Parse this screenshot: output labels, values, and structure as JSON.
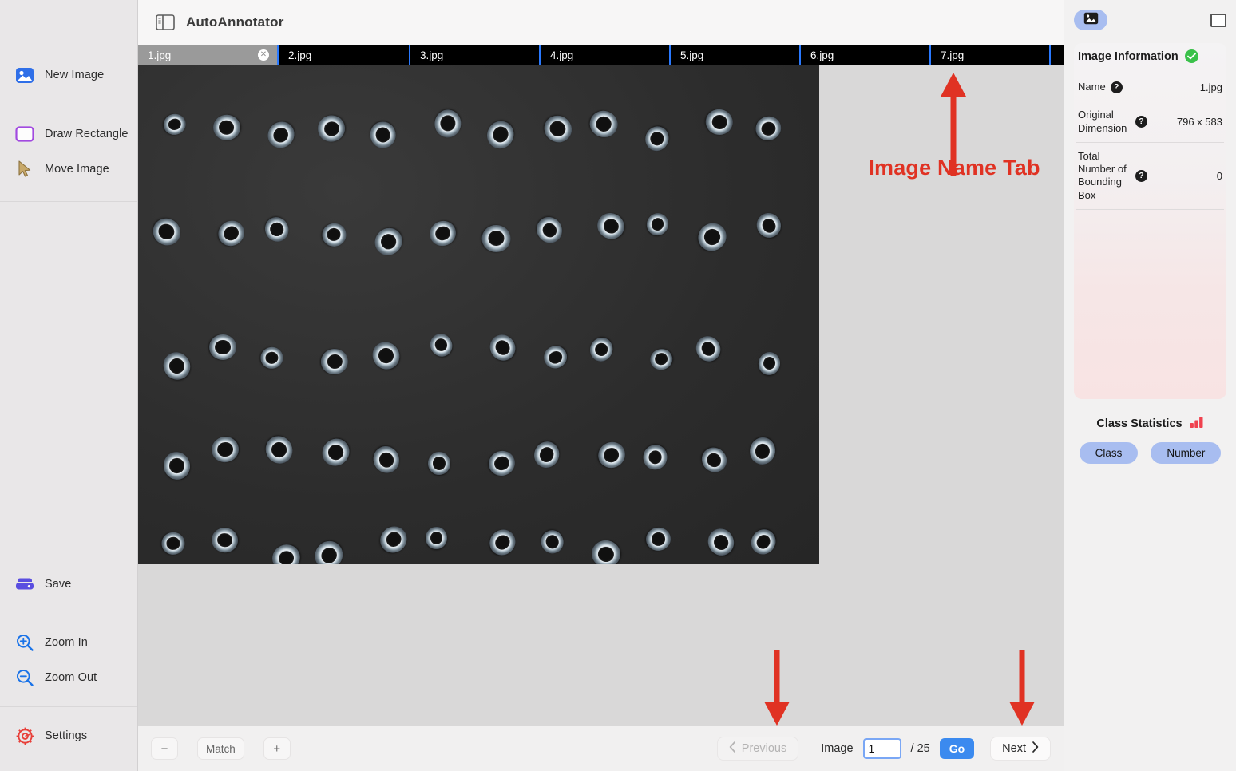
{
  "app": {
    "title": "AutoAnnotator",
    "panel_toggle_icon": "sidebar-panel-icon"
  },
  "sidebar": {
    "items": [
      {
        "label": "New Image",
        "icon": "image-plus-icon"
      },
      {
        "label": "Draw Rectangle",
        "icon": "rectangle-icon"
      },
      {
        "label": "Move Image",
        "icon": "cursor-arrow-icon"
      },
      {
        "label": "Save",
        "icon": "floppy-disk-icon"
      },
      {
        "label": "Zoom In",
        "icon": "magnifier-plus-icon"
      },
      {
        "label": "Zoom Out",
        "icon": "magnifier-minus-icon"
      },
      {
        "label": "Settings",
        "icon": "gear-icon"
      }
    ]
  },
  "tabs": {
    "items": [
      {
        "label": "1.jpg",
        "active": true,
        "closable": true
      },
      {
        "label": "2.jpg",
        "active": false,
        "closable": false
      },
      {
        "label": "3.jpg",
        "active": false,
        "closable": false
      },
      {
        "label": "4.jpg",
        "active": false,
        "closable": false
      },
      {
        "label": "5.jpg",
        "active": false,
        "closable": false
      },
      {
        "label": "6.jpg",
        "active": false,
        "closable": false
      },
      {
        "label": "7.jpg",
        "active": false,
        "closable": false
      }
    ],
    "close_glyph": "✕"
  },
  "bottombar": {
    "zoom_out_label": "−",
    "match_label": "Match",
    "zoom_in_label": "+",
    "previous_label": "Previous",
    "previous_icon": "chevron-left-icon",
    "image_label": "Image",
    "page_value": "1",
    "page_total": "/ 25",
    "go_label": "Go",
    "next_label": "Next",
    "next_icon": "chevron-right-icon"
  },
  "right_panel": {
    "tab_image_icon": "image-icon",
    "tab_box_icon": "bounding-box-icon",
    "info_title": "Image Information",
    "info_status_icon": "check-circle-icon",
    "rows": [
      {
        "key": "Name",
        "help": "?",
        "value": "1.jpg"
      },
      {
        "key": "Original Dimension",
        "help": "?",
        "value": "796 x 583"
      },
      {
        "key": "Total Number of Bounding Box",
        "help": "?",
        "value": "0"
      }
    ],
    "stats_title": "Class Statistics",
    "stats_icon": "bar-chart-icon",
    "pills": [
      {
        "label": "Class"
      },
      {
        "label": "Number"
      }
    ]
  },
  "annotations": {
    "accent_color": "#e03223",
    "callouts": [
      {
        "text": "Image Name Tab",
        "arrow": "arrow-up-icon"
      },
      {
        "text": "",
        "arrow": "arrow-down-icon"
      },
      {
        "text": "",
        "arrow": "arrow-down-icon"
      }
    ]
  },
  "photo": {
    "alt": "photograph of metal lock washers arranged in rows on dark background",
    "rows": 5,
    "per_row": 12
  }
}
